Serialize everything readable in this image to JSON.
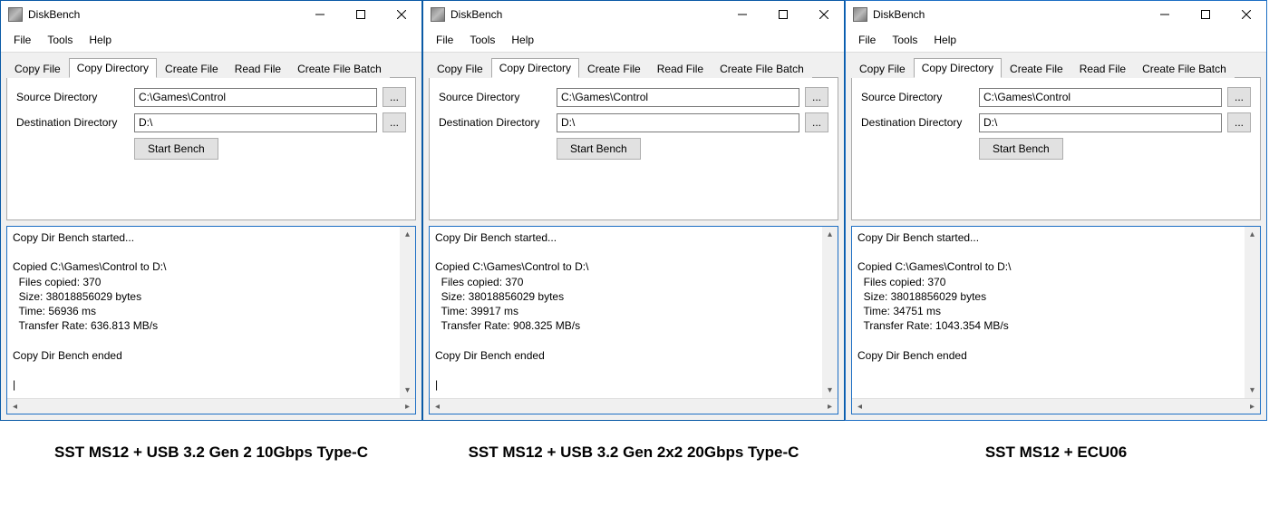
{
  "app_title": "DiskBench",
  "menus": [
    "File",
    "Tools",
    "Help"
  ],
  "tabs": [
    "Copy File",
    "Copy Directory",
    "Create File",
    "Read File",
    "Create File Batch"
  ],
  "active_tab": "Copy Directory",
  "labels": {
    "source": "Source Directory",
    "destination": "Destination Directory",
    "start": "Start Bench",
    "browse": "..."
  },
  "inputs": {
    "source_value": "C:\\Games\\Control",
    "destination_value": "D:\\"
  },
  "windows": [
    {
      "caption": "SST MS12 + USB 3.2 Gen 2 10Gbps Type-C",
      "results": "Copy Dir Bench started...\n\nCopied C:\\Games\\Control to D:\\\n  Files copied: 370\n  Size: 38018856029 bytes\n  Time: 56936 ms\n  Transfer Rate: 636.813 MB/s\n\nCopy Dir Bench ended\n"
    },
    {
      "caption": "SST MS12 + USB 3.2 Gen 2x2 20Gbps Type-C",
      "results": "Copy Dir Bench started...\n\nCopied C:\\Games\\Control to D:\\\n  Files copied: 370\n  Size: 38018856029 bytes\n  Time: 39917 ms\n  Transfer Rate: 908.325 MB/s\n\nCopy Dir Bench ended\n"
    },
    {
      "caption": "SST MS12 + ECU06",
      "results": "Copy Dir Bench started...\n\nCopied C:\\Games\\Control to D:\\\n  Files copied: 370\n  Size: 38018856029 bytes\n  Time: 34751 ms\n  Transfer Rate: 1043.354 MB/s\n\nCopy Dir Bench ended"
    }
  ]
}
